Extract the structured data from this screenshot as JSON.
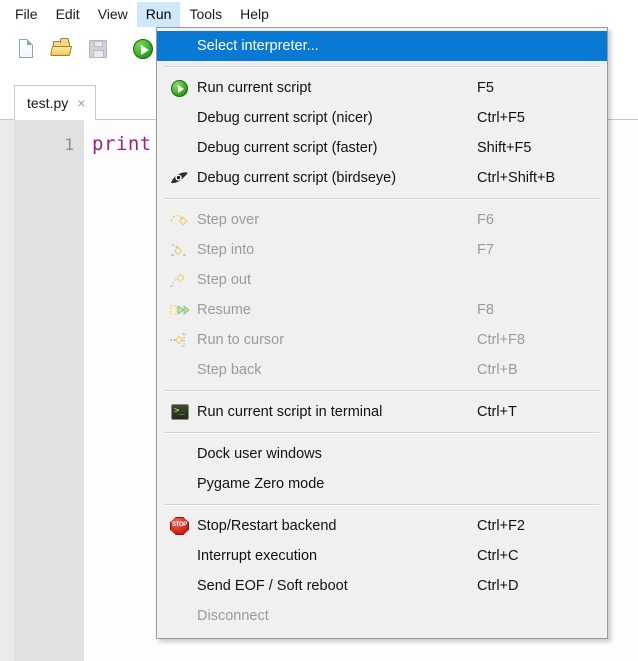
{
  "menubar": {
    "items": [
      {
        "label": "File",
        "active": false
      },
      {
        "label": "Edit",
        "active": false
      },
      {
        "label": "View",
        "active": false
      },
      {
        "label": "Run",
        "active": true
      },
      {
        "label": "Tools",
        "active": false
      },
      {
        "label": "Help",
        "active": false
      }
    ]
  },
  "toolbar": {
    "buttons": [
      {
        "icon": "new-file-icon",
        "enabled": true
      },
      {
        "icon": "open-folder-icon",
        "enabled": true
      },
      {
        "icon": "save-icon",
        "enabled": false
      },
      {
        "icon": "run-icon",
        "enabled": true
      }
    ]
  },
  "tabs": {
    "items": [
      {
        "label": "test.py",
        "close": "×",
        "active": true
      }
    ]
  },
  "editor": {
    "lines": [
      {
        "number": "1",
        "text": "print"
      }
    ],
    "keyword_color": "#a02080"
  },
  "run_menu": {
    "title": "Run",
    "groups": [
      {
        "items": [
          {
            "label": "Select interpreter...",
            "accel": "",
            "icon": "",
            "disabled": false,
            "highlight": true
          }
        ]
      },
      {
        "items": [
          {
            "label": "Run current script",
            "accel": "F5",
            "icon": "run-icon",
            "disabled": false,
            "highlight": false
          },
          {
            "label": "Debug current script (nicer)",
            "accel": "Ctrl+F5",
            "icon": "",
            "disabled": false,
            "highlight": false
          },
          {
            "label": "Debug current script (faster)",
            "accel": "Shift+F5",
            "icon": "",
            "disabled": false,
            "highlight": false
          },
          {
            "label": "Debug current script (birdseye)",
            "accel": "Ctrl+Shift+B",
            "icon": "birdseye-icon",
            "disabled": false,
            "highlight": false
          }
        ]
      },
      {
        "items": [
          {
            "label": "Step over",
            "accel": "F6",
            "icon": "step-over-icon",
            "disabled": true,
            "highlight": false
          },
          {
            "label": "Step into",
            "accel": "F7",
            "icon": "step-into-icon",
            "disabled": true,
            "highlight": false
          },
          {
            "label": "Step out",
            "accel": "",
            "icon": "step-out-icon",
            "disabled": true,
            "highlight": false
          },
          {
            "label": "Resume",
            "accel": "F8",
            "icon": "resume-icon",
            "disabled": true,
            "highlight": false
          },
          {
            "label": "Run to cursor",
            "accel": "Ctrl+F8",
            "icon": "run-to-cursor-icon",
            "disabled": true,
            "highlight": false
          },
          {
            "label": "Step back",
            "accel": "Ctrl+B",
            "icon": "",
            "disabled": true,
            "highlight": false
          }
        ]
      },
      {
        "items": [
          {
            "label": "Run current script in terminal",
            "accel": "Ctrl+T",
            "icon": "terminal-icon",
            "disabled": false,
            "highlight": false
          }
        ]
      },
      {
        "items": [
          {
            "label": "Dock user windows",
            "accel": "",
            "icon": "",
            "disabled": false,
            "highlight": false
          },
          {
            "label": "Pygame Zero mode",
            "accel": "",
            "icon": "",
            "disabled": false,
            "highlight": false
          }
        ]
      },
      {
        "items": [
          {
            "label": "Stop/Restart backend",
            "accel": "Ctrl+F2",
            "icon": "stop-icon",
            "disabled": false,
            "highlight": false
          },
          {
            "label": "Interrupt execution",
            "accel": "Ctrl+C",
            "icon": "",
            "disabled": false,
            "highlight": false
          },
          {
            "label": "Send EOF / Soft reboot",
            "accel": "Ctrl+D",
            "icon": "",
            "disabled": false,
            "highlight": false
          },
          {
            "label": "Disconnect",
            "accel": "",
            "icon": "",
            "disabled": true,
            "highlight": false
          }
        ]
      }
    ]
  },
  "colors": {
    "highlight": "#0a79d4",
    "menu_bg": "#f0f0f0",
    "menubar_active": "#cfe8fb",
    "disabled_text": "#9b9b9b"
  }
}
